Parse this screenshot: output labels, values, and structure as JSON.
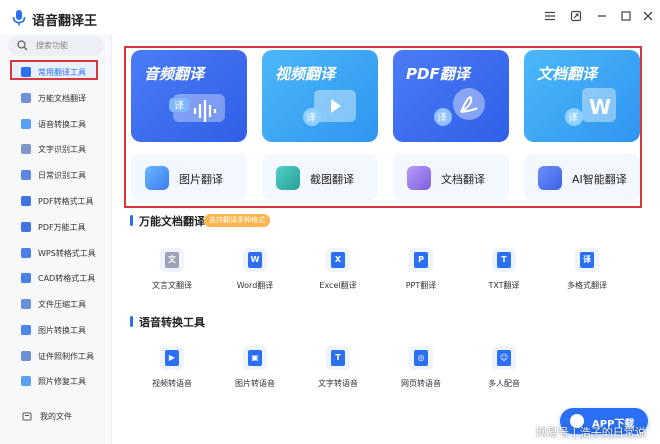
{
  "app": {
    "title": "语音翻译王",
    "brand_color": "#2b6ff5",
    "highlight_color": "#d9363e"
  },
  "window_controls": [
    "menu-icon",
    "pin-icon",
    "minimize-icon",
    "maximize-icon",
    "close-icon"
  ],
  "sidebar": {
    "search_placeholder": "搜索功能",
    "items": [
      {
        "label": "常用翻译工具",
        "icon": "translate-icon",
        "active": true
      },
      {
        "label": "万能文档翻译",
        "icon": "doc-icon"
      },
      {
        "label": "语音转换工具",
        "icon": "voice-icon"
      },
      {
        "label": "文字识别工具",
        "icon": "text-recognize-icon"
      },
      {
        "label": "日常识别工具",
        "icon": "daily-recognize-icon"
      },
      {
        "label": "PDF转格式工具",
        "icon": "pdf-icon"
      },
      {
        "label": "PDF万能工具",
        "icon": "pdf-tools-icon"
      },
      {
        "label": "WPS转格式工具",
        "icon": "wps-icon"
      },
      {
        "label": "CAD转格式工具",
        "icon": "cad-icon"
      },
      {
        "label": "文件压缩工具",
        "icon": "compress-icon"
      },
      {
        "label": "图片转换工具",
        "icon": "image-convert-icon"
      },
      {
        "label": "证件照制作工具",
        "icon": "id-photo-icon"
      },
      {
        "label": "照片修复工具",
        "icon": "photo-repair-icon"
      }
    ],
    "footer_label": "我的文件"
  },
  "featured": {
    "big_cards": [
      {
        "title": "音频翻译",
        "color": "#3d6ef3"
      },
      {
        "title": "视频翻译",
        "color": "#35a7f5"
      },
      {
        "title": "PDF翻译",
        "color": "#3a6df4"
      },
      {
        "title": "文档翻译",
        "color": "#36a9f6"
      }
    ],
    "small_cards": [
      {
        "label": "图片翻译",
        "icon": "image-translate-icon"
      },
      {
        "label": "截图翻译",
        "icon": "screenshot-translate-icon"
      },
      {
        "label": "文档翻译",
        "icon": "doc-translate-icon"
      },
      {
        "label": "AI智能翻译",
        "icon": "ai-translate-icon"
      }
    ]
  },
  "doc_section": {
    "title": "万能文档翻译",
    "badge": "支持翻译多种格式",
    "tools": [
      {
        "label": "文言文翻译",
        "glyph": "文",
        "color": "#9aa4b5"
      },
      {
        "label": "Word翻译",
        "glyph": "W",
        "color": "#2b6ff5"
      },
      {
        "label": "Excel翻译",
        "glyph": "X",
        "color": "#2b6ff5"
      },
      {
        "label": "PPT翻译",
        "glyph": "P",
        "color": "#2b6ff5"
      },
      {
        "label": "TXT翻译",
        "glyph": "T",
        "color": "#2b6ff5"
      },
      {
        "label": "多格式翻译",
        "glyph": "译",
        "color": "#2b6ff5"
      }
    ]
  },
  "voice_section": {
    "title": "语音转换工具",
    "tools": [
      {
        "label": "视频转语音",
        "glyph": "▶",
        "color": "#2b6ff5"
      },
      {
        "label": "图片转语音",
        "glyph": "▣",
        "color": "#2b6ff5"
      },
      {
        "label": "文字转语音",
        "glyph": "T",
        "color": "#2b6ff5"
      },
      {
        "label": "网页转语音",
        "glyph": "◎",
        "color": "#2b6ff5"
      },
      {
        "label": "多人配音",
        "glyph": "☺",
        "color": "#2b6ff5"
      }
    ]
  },
  "app_download": {
    "label": "APP下载"
  },
  "watermark": "网易号 | 浩子的日常说"
}
